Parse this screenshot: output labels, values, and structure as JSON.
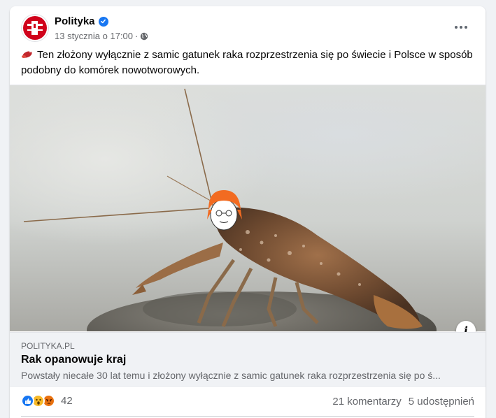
{
  "post": {
    "page_name": "Polityka",
    "date": "13 stycznia o 17:00",
    "separator": "·",
    "text": "Ten złożony wyłącznie z samic gatunek raka rozprzestrzenia się po świecie i Polsce w sposób podobny do komórek nowotworowych.",
    "emoji_icon": "lobster-emoji"
  },
  "link": {
    "domain": "POLITYKA.PL",
    "title": "Rak opanowuje kraj",
    "description": "Powstały niecałe 30 lat temu i złożony wyłącznie z samic gatunek raka rozprzestrzenia się po ś..."
  },
  "stats": {
    "reaction_count": "42",
    "comments": "21 komentarzy",
    "shares": "5 udostępnień",
    "reactions": [
      "like",
      "wow",
      "angry"
    ]
  },
  "colors": {
    "brand_red": "#d0021b",
    "verified_blue": "#1877f2",
    "like_blue": "#1877f2",
    "wow_yellow": "#f7b928",
    "angry_orange": "#e9710f"
  }
}
